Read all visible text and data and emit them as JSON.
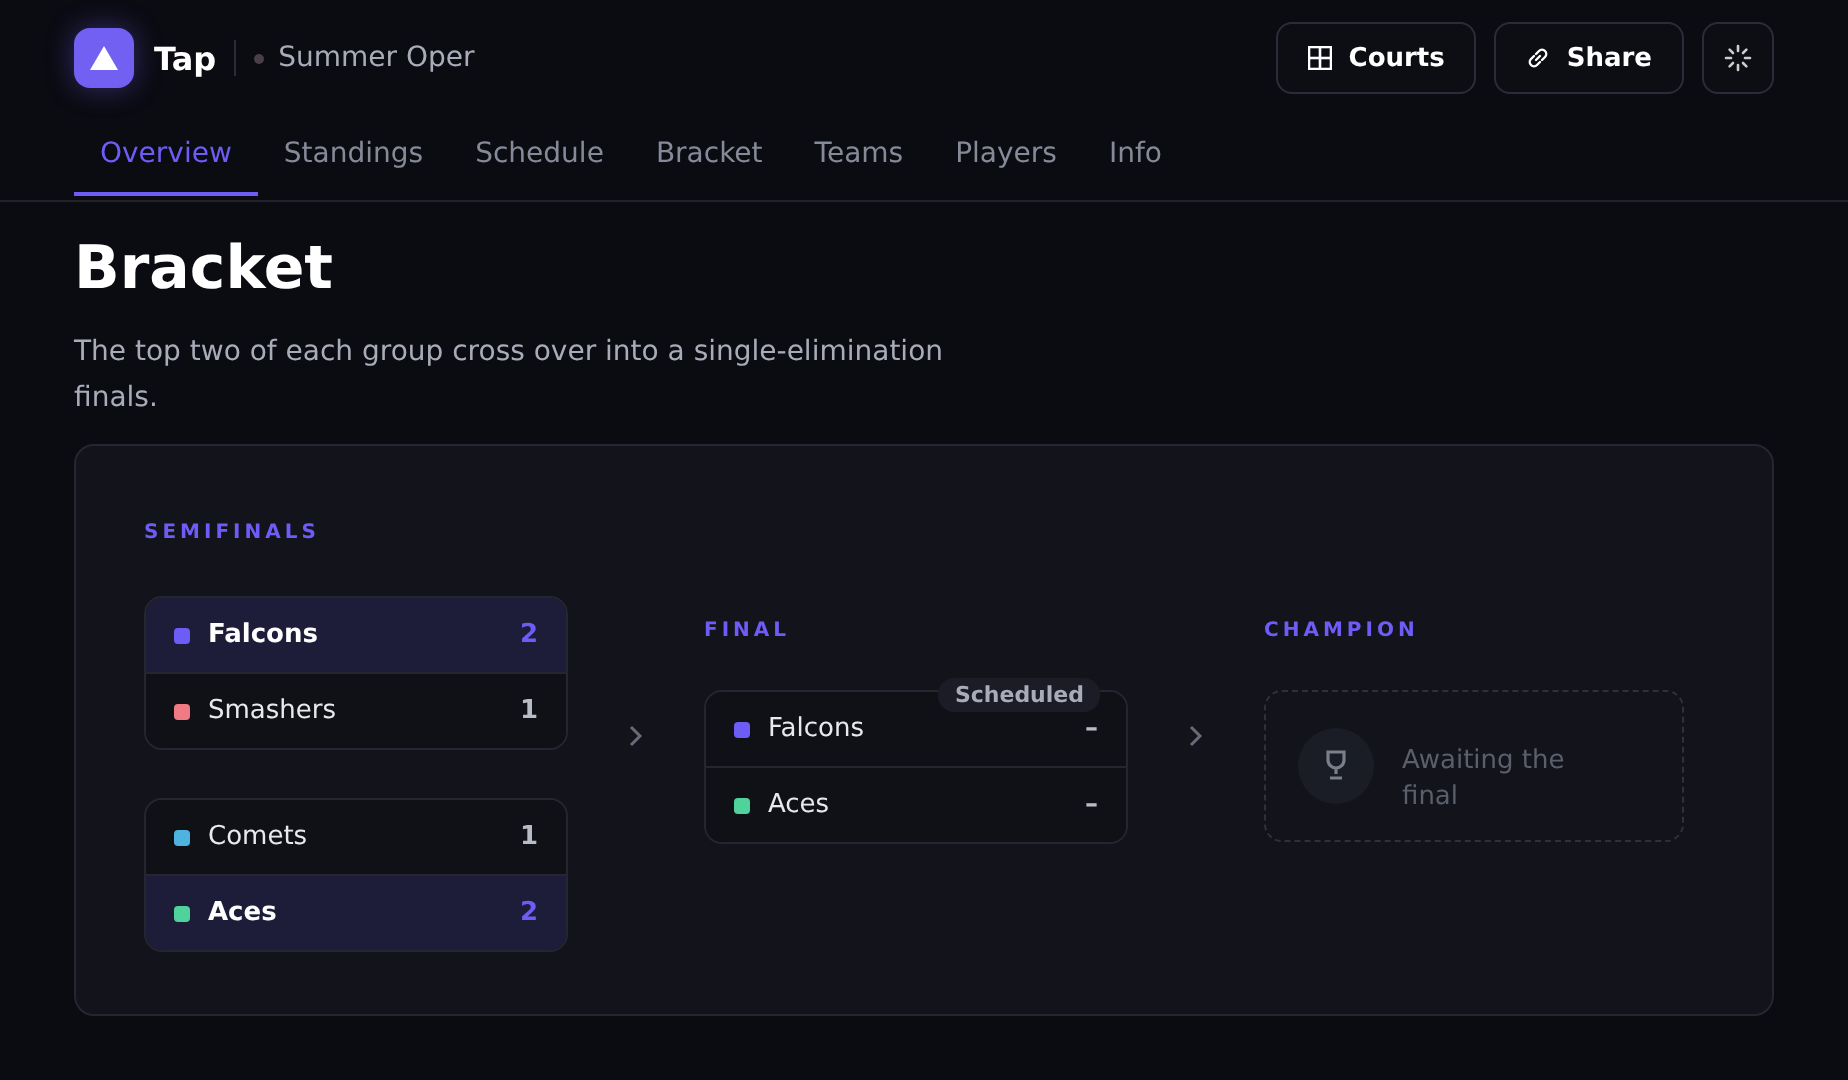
{
  "app": {
    "name": "Tap",
    "event": "Summer Oper"
  },
  "actions": [
    {
      "kind": "courts",
      "label": "Courts"
    },
    {
      "kind": "share",
      "label": "Share"
    },
    {
      "kind": "theme"
    }
  ],
  "tabs": [
    {
      "label": "Overview",
      "selected": true
    },
    {
      "label": "Standings",
      "selected": false
    },
    {
      "label": "Schedule",
      "selected": false
    },
    {
      "label": "Bracket",
      "selected": false
    },
    {
      "label": "Teams",
      "selected": false
    },
    {
      "label": "Players",
      "selected": false
    },
    {
      "label": "Info",
      "selected": false
    }
  ],
  "page": {
    "title": "Bracket",
    "description": "The top two of each group cross over into a single-elimination finals."
  },
  "semifinals": {
    "label": "SEMIFINALS",
    "matches": [
      {
        "teams": [
          {
            "name": "Falcons",
            "color": "#6e5cf6",
            "score": "2",
            "winner": true
          },
          {
            "name": "Smashers",
            "color": "#f07b84",
            "score": "1",
            "winner": false
          }
        ]
      },
      {
        "teams": [
          {
            "name": "Comets",
            "color": "#4fb3e0",
            "score": "1",
            "winner": false
          },
          {
            "name": "Aces",
            "color": "#4fd39a",
            "score": "2",
            "winner": true
          }
        ]
      }
    ]
  },
  "final": {
    "label": "FINAL",
    "status": "Scheduled",
    "teams": [
      {
        "name": "Falcons",
        "color": "#6e5cf6",
        "score": "–",
        "winner": false
      },
      {
        "name": "Aces",
        "color": "#4fd39a",
        "score": "–",
        "winner": false
      }
    ]
  },
  "champion": {
    "label": "CHAMPION",
    "text": "Awaiting the final"
  }
}
